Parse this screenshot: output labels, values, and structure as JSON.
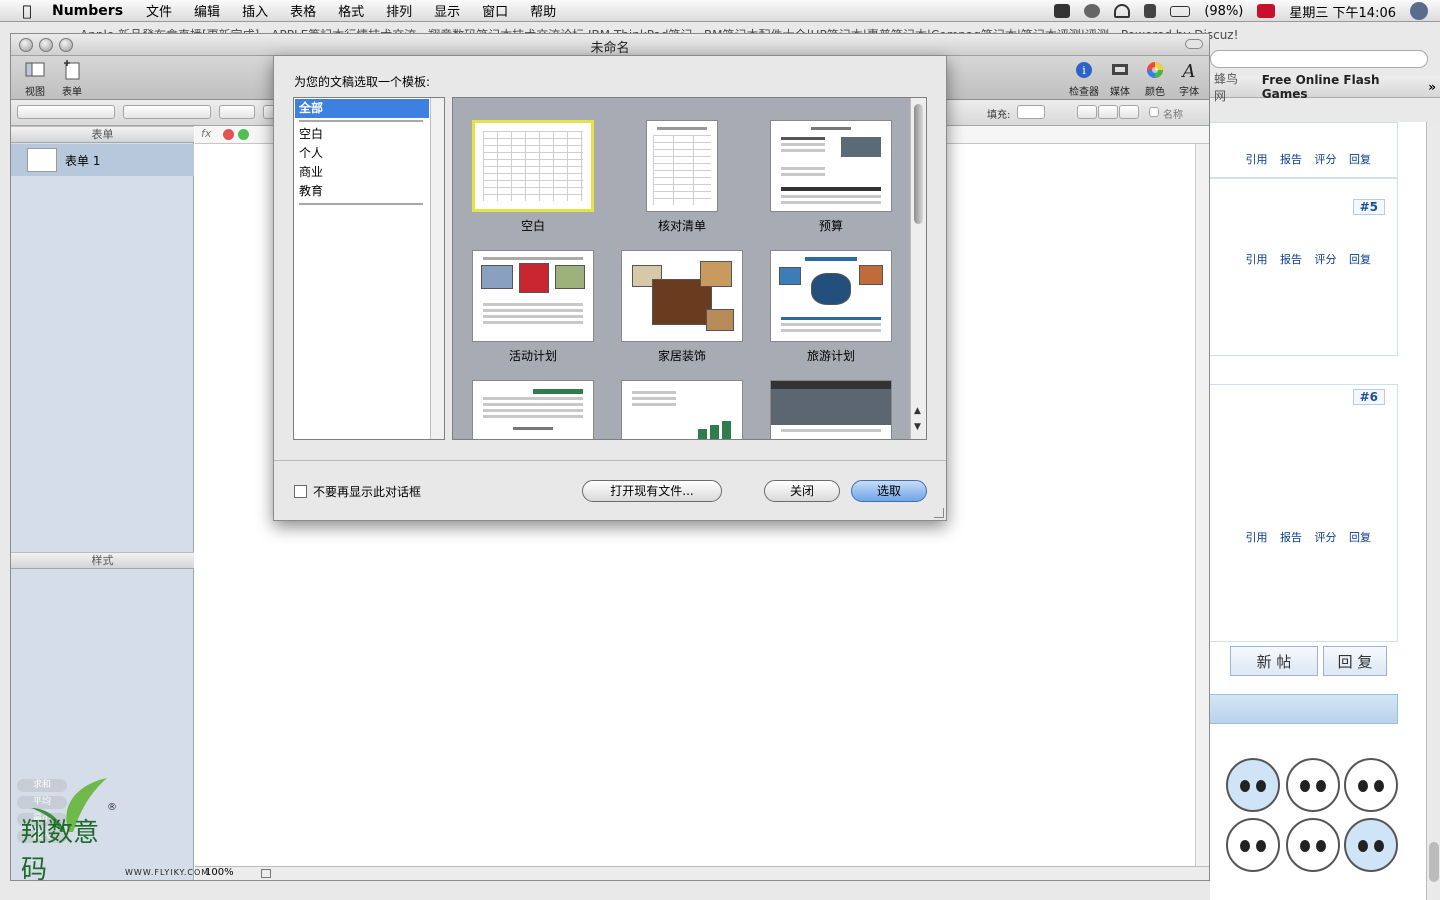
{
  "menubar": {
    "app_name": "Numbers",
    "items": [
      "文件",
      "编辑",
      "插入",
      "表格",
      "格式",
      "排列",
      "显示",
      "窗口",
      "帮助"
    ],
    "battery": "(98%)",
    "clock": "星期三 下午14:06"
  },
  "browser": {
    "tab_text": "Apple 新品發布會直播[更新完成] - APPLE筆記本行情技术交流 - 翔意数码笔记本技术交流论坛 IBM ThinkPad笔记...BM笔记本配件大全|HP笔记本|惠普笔记本|Compaq笔记本|笔记本评测|评测 - Powered by Discuz!",
    "bookmark_1": "蜂鸟网",
    "bookmark_2": "Free Online Flash Games",
    "bookmark_more": "»",
    "post_links": [
      "引用",
      "报告",
      "评分",
      "回复"
    ],
    "post_5": "#5",
    "post_6": "#6",
    "new_post_btn": "新 帖",
    "reply_btn": "回 复"
  },
  "numbers_window": {
    "title": "未命名",
    "toolbar": {
      "view": "视图",
      "sheet": "表单",
      "inspector": "检查器",
      "media": "媒体",
      "colors": "颜色",
      "fonts": "字体"
    },
    "format_bar": {
      "fill_label": "填充:",
      "name_label": "名称"
    },
    "sidebar": {
      "sheets_header": "表单",
      "sheet_name": "表单 1",
      "styles_header": "样式",
      "sum_items": [
        "求和",
        "平均",
        "最小",
        "最大"
      ]
    },
    "zoom": "100%",
    "watermark": {
      "logo_text": "翔数意码",
      "registered": "®",
      "url": "WWW.FLYIKY.COM"
    }
  },
  "dialog": {
    "prompt": "为您的文稿选取一个模板:",
    "categories": [
      {
        "label": "全部",
        "selected": true
      },
      {
        "label": "空白",
        "selected": false
      },
      {
        "label": "个人",
        "selected": false
      },
      {
        "label": "商业",
        "selected": false
      },
      {
        "label": "教育",
        "selected": false
      }
    ],
    "templates": [
      {
        "name": "空白",
        "selected": true
      },
      {
        "name": "核对清单",
        "selected": false
      },
      {
        "name": "预算",
        "selected": false
      },
      {
        "name": "活动计划",
        "selected": false
      },
      {
        "name": "家居装饰",
        "selected": false
      },
      {
        "name": "旅游计划",
        "selected": false
      },
      {
        "name": "",
        "selected": false
      },
      {
        "name": "",
        "selected": false
      },
      {
        "name": "",
        "selected": false
      }
    ],
    "dont_show_label": "不要再显示此对话框",
    "open_existing_btn": "打开现有文件...",
    "close_btn": "关闭",
    "choose_btn": "选取"
  },
  "colors": {
    "selection_blue": "#3d80df",
    "selected_template_border": "#e6e344",
    "default_button": "#6fa5e8"
  }
}
